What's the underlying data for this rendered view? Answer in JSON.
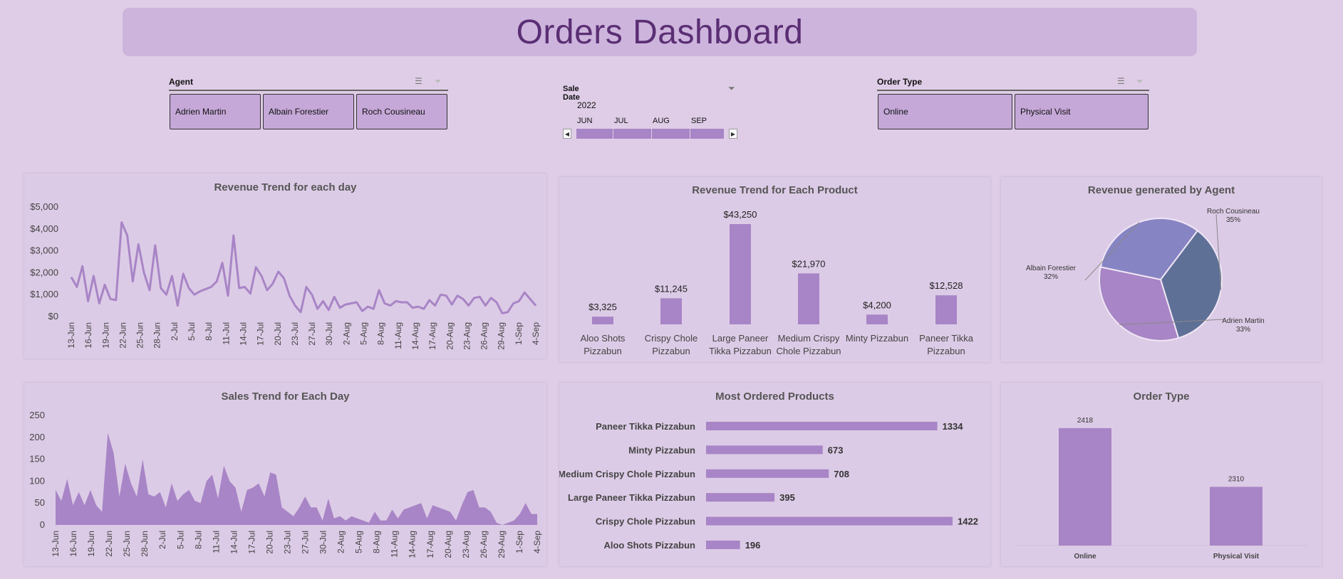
{
  "title": "Orders Dashboard",
  "slicers": {
    "agent": {
      "title": "Agent",
      "items": [
        "Adrien Martin",
        "Albain Forestier",
        "Roch Cousineau"
      ]
    },
    "sale_date": {
      "title": "Sale Date",
      "year": "2022",
      "months": [
        "JUN",
        "JUL",
        "AUG",
        "SEP"
      ]
    },
    "order_type": {
      "title": "Order Type",
      "items": [
        "Online",
        "Physical Visit"
      ]
    }
  },
  "colors": {
    "accent": "#a885c6",
    "banner": "#cdb4dc",
    "title_text": "#5a2e74",
    "pie_roch": "#5f7097",
    "pie_albain": "#8784c4",
    "pie_adrien": "#a885c6"
  },
  "chart_data": [
    {
      "id": "revenue_day",
      "type": "line",
      "title": "Revenue Trend for each day",
      "x_tick_labels": [
        "13-Jun",
        "16-Jun",
        "19-Jun",
        "22-Jun",
        "25-Jun",
        "28-Jun",
        "2-Jul",
        "5-Jul",
        "8-Jul",
        "11-Jul",
        "14-Jul",
        "17-Jul",
        "20-Jul",
        "23-Jul",
        "27-Jul",
        "30-Jul",
        "2-Aug",
        "5-Aug",
        "8-Aug",
        "11-Aug",
        "14-Aug",
        "17-Aug",
        "20-Aug",
        "23-Aug",
        "26-Aug",
        "29-Aug",
        "1-Sep",
        "4-Sep"
      ],
      "y_tick_labels": [
        "$0",
        "$1,000",
        "$2,000",
        "$3,000",
        "$4,000",
        "$5,000"
      ],
      "ylim": [
        0,
        5000
      ],
      "values": [
        1800,
        1350,
        2300,
        700,
        1850,
        600,
        1450,
        800,
        750,
        4300,
        3700,
        1600,
        3300,
        2000,
        1200,
        3250,
        1300,
        1000,
        1850,
        500,
        1950,
        1300,
        1000,
        1150,
        1250,
        1350,
        1600,
        2450,
        950,
        3700,
        1300,
        1350,
        1050,
        2250,
        1850,
        1200,
        1500,
        2050,
        1750,
        950,
        500,
        200,
        1350,
        1000,
        350,
        700,
        300,
        900,
        400,
        550,
        600,
        650,
        250,
        450,
        350,
        1200,
        600,
        500,
        700,
        650,
        650,
        400,
        450,
        350,
        750,
        500,
        1000,
        950,
        550,
        950,
        800,
        500,
        850,
        900,
        500,
        850,
        650,
        150,
        200,
        600,
        700,
        1100,
        800,
        500
      ]
    },
    {
      "id": "revenue_product",
      "type": "bar",
      "title": "Revenue Trend for Each Product",
      "categories": [
        [
          "Aloo Shots",
          "Pizzabun"
        ],
        [
          "Crispy Chole",
          "Pizzabun"
        ],
        [
          "Large Paneer",
          "Tikka Pizzabun"
        ],
        [
          "Medium Crispy",
          "Chole Pizzabun"
        ],
        [
          "Minty Pizzabun"
        ],
        [
          "Paneer Tikka",
          "Pizzabun"
        ]
      ],
      "values": [
        3325,
        11245,
        43250,
        21970,
        4200,
        12528
      ],
      "data_labels": [
        "$3,325",
        "$11,245",
        "$43,250",
        "$21,970",
        "$4,200",
        "$12,528"
      ]
    },
    {
      "id": "revenue_agent",
      "type": "pie",
      "title": "Revenue generated by Agent",
      "slices": [
        {
          "name": "Roch Cousineau",
          "value": 35,
          "label": "35%"
        },
        {
          "name": "Adrien Martin",
          "value": 33,
          "label": "33%"
        },
        {
          "name": "Albain Forestier",
          "value": 32,
          "label": "32%"
        }
      ]
    },
    {
      "id": "sales_day",
      "type": "area",
      "title": "Sales Trend for Each Day",
      "x_tick_labels": [
        "13-Jun",
        "16-Jun",
        "19-Jun",
        "22-Jun",
        "25-Jun",
        "28-Jun",
        "2-Jul",
        "5-Jul",
        "8-Jul",
        "11-Jul",
        "14-Jul",
        "17-Jul",
        "20-Jul",
        "23-Jul",
        "27-Jul",
        "30-Jul",
        "2-Aug",
        "5-Aug",
        "8-Aug",
        "11-Aug",
        "14-Aug",
        "17-Aug",
        "20-Aug",
        "23-Aug",
        "26-Aug",
        "29-Aug",
        "1-Sep",
        "4-Sep"
      ],
      "y_tick_labels": [
        "0",
        "50",
        "100",
        "150",
        "200",
        "250"
      ],
      "ylim": [
        0,
        250
      ],
      "values": [
        80,
        55,
        105,
        45,
        75,
        45,
        80,
        45,
        30,
        210,
        165,
        65,
        140,
        95,
        65,
        150,
        70,
        65,
        75,
        40,
        95,
        55,
        70,
        80,
        55,
        50,
        100,
        115,
        60,
        135,
        100,
        85,
        30,
        80,
        85,
        95,
        65,
        120,
        115,
        40,
        30,
        20,
        40,
        65,
        40,
        40,
        10,
        60,
        15,
        20,
        10,
        20,
        15,
        10,
        5,
        30,
        10,
        10,
        35,
        15,
        35,
        40,
        45,
        50,
        15,
        45,
        40,
        35,
        30,
        10,
        45,
        75,
        80,
        40,
        40,
        30,
        5,
        0,
        5,
        10,
        25,
        50,
        25,
        25
      ]
    },
    {
      "id": "most_ordered",
      "type": "bar",
      "orientation": "horizontal",
      "title": "Most Ordered Products",
      "categories": [
        "Paneer Tikka Pizzabun",
        "Minty Pizzabun",
        "Medium Crispy Chole Pizzabun",
        "Large Paneer Tikka Pizzabun",
        "Crispy Chole Pizzabun",
        "Aloo Shots Pizzabun"
      ],
      "values": [
        1334,
        673,
        708,
        395,
        1422,
        196
      ],
      "data_labels": [
        "1334",
        "673",
        "708",
        "395",
        "1422",
        "196"
      ]
    },
    {
      "id": "order_type",
      "type": "bar",
      "title": "Order Type",
      "categories": [
        "Online",
        "Physical Visit"
      ],
      "values": [
        2418,
        2310
      ],
      "data_labels": [
        "2418",
        "2310"
      ],
      "bar_fill_fraction": [
        0.96,
        0.48
      ]
    }
  ]
}
